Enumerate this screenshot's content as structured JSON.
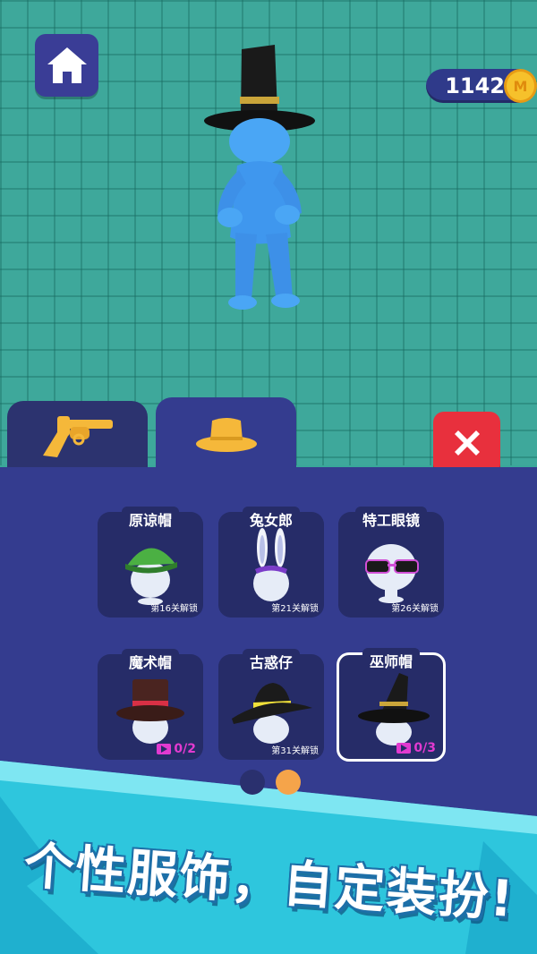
{
  "hud": {
    "coins": "1142",
    "coin_symbol": "M"
  },
  "tabs": [
    {
      "name": "weapons",
      "icon": "revolver-icon",
      "active": false
    },
    {
      "name": "hats",
      "icon": "hat-icon",
      "active": true
    }
  ],
  "items": [
    {
      "title": "原谅帽",
      "lock_text": "第16关解锁",
      "icon": "green-cap-icon",
      "selected": false
    },
    {
      "title": "兔女郎",
      "lock_text": "第21关解锁",
      "icon": "bunny-ears-icon",
      "selected": false
    },
    {
      "title": "特工眼镜",
      "lock_text": "第26关解锁",
      "icon": "agent-glasses-icon",
      "selected": false
    },
    {
      "title": "魔术帽",
      "video_progress": "0/2",
      "icon": "magic-top-hat-icon",
      "selected": false
    },
    {
      "title": "古惑仔",
      "lock_text": "第31关解锁",
      "icon": "fedora-icon",
      "selected": false
    },
    {
      "title": "巫师帽",
      "video_progress": "0/3",
      "icon": "witch-hat-icon",
      "selected": true
    }
  ],
  "pagination": {
    "pages": 2,
    "current": 2
  },
  "banner": {
    "slogan": "个性服饰，自定装扮!"
  },
  "colors": {
    "background": "#3ea89b",
    "panel": "#343c8f",
    "card": "#262c68",
    "close": "#e8303d",
    "accent_orange": "#f5a44a",
    "video": "#e23ad0",
    "character": "#4aa6f5"
  }
}
